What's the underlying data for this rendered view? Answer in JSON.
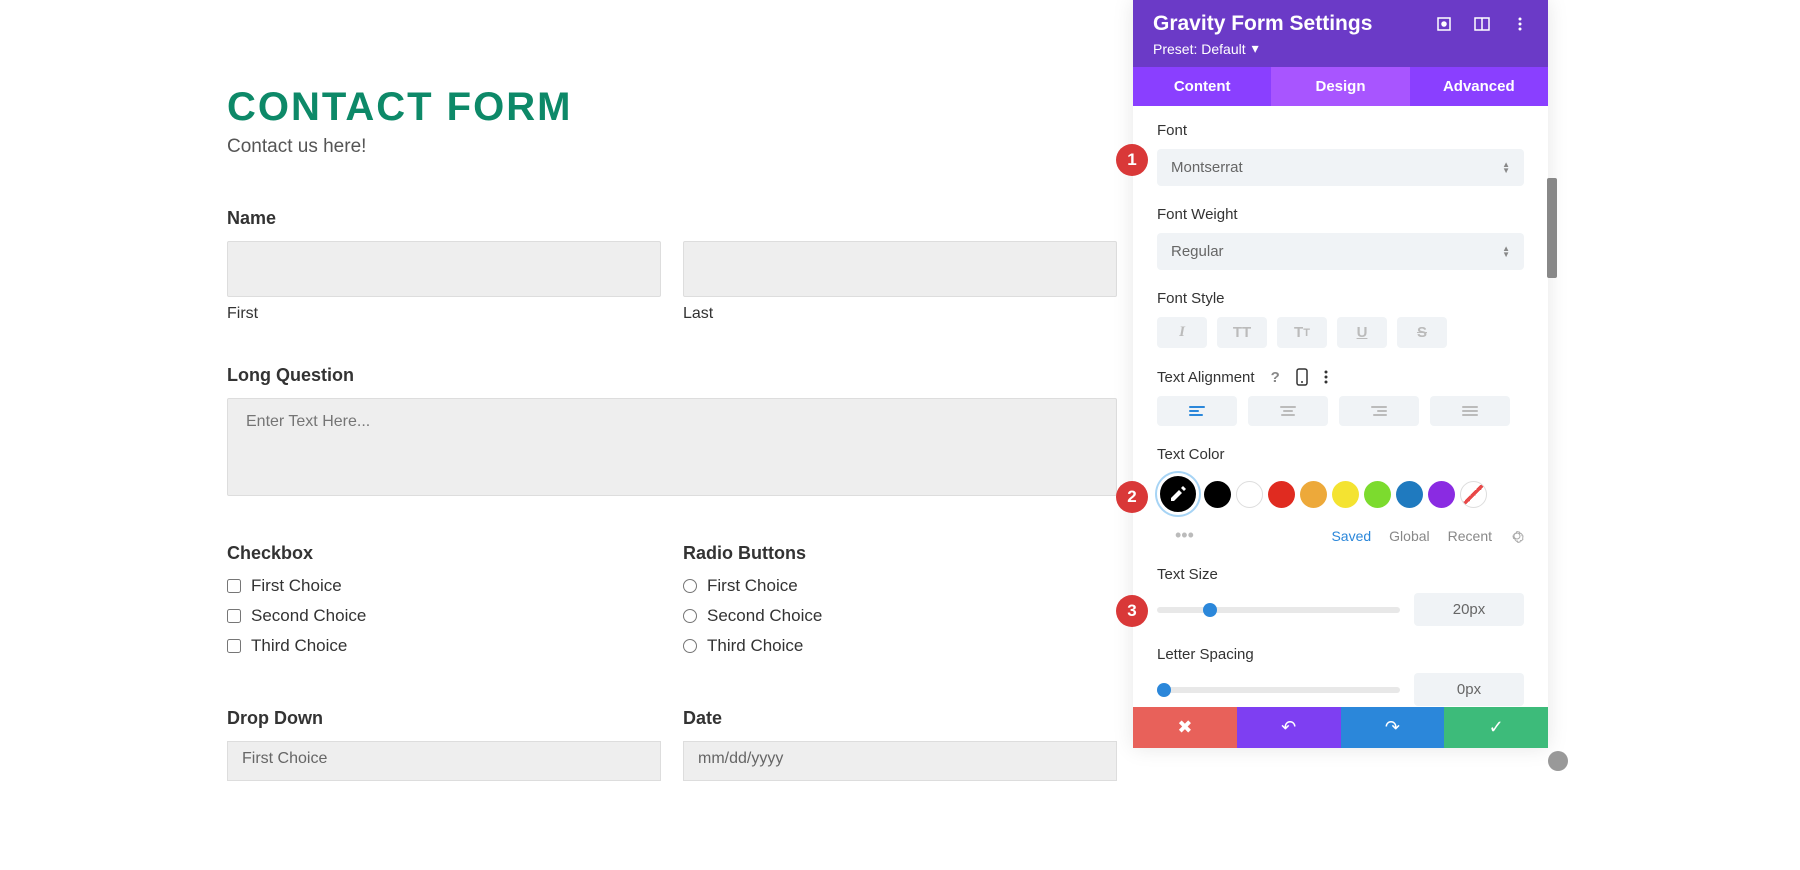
{
  "form": {
    "title": "CONTACT FORM",
    "subtitle": "Contact us here!",
    "name_label": "Name",
    "first_label": "First",
    "last_label": "Last",
    "long_question_label": "Long Question",
    "long_question_placeholder": "Enter Text Here...",
    "checkbox_label": "Checkbox",
    "radio_label": "Radio Buttons",
    "choices": [
      "First Choice",
      "Second Choice",
      "Third Choice"
    ],
    "dropdown_label": "Drop Down",
    "dropdown_value": "First Choice",
    "date_label": "Date",
    "date_placeholder": "mm/dd/yyyy"
  },
  "panel": {
    "title": "Gravity Form Settings",
    "preset_label": "Preset: Default",
    "tabs": {
      "content": "Content",
      "design": "Design",
      "advanced": "Advanced"
    },
    "font_label": "Font",
    "font_value": "Montserrat",
    "font_weight_label": "Font Weight",
    "font_weight_value": "Regular",
    "font_style_label": "Font Style",
    "text_alignment_label": "Text Alignment",
    "text_color_label": "Text Color",
    "color_tabs": {
      "saved": "Saved",
      "global": "Global",
      "recent": "Recent"
    },
    "text_size_label": "Text Size",
    "text_size_value": "20px",
    "letter_spacing_label": "Letter Spacing",
    "letter_spacing_value": "0px",
    "colors": [
      "#000000",
      "#ffffff",
      "#e02b20",
      "#eda93a",
      "#f4e331",
      "#7cdb2e",
      "#1f7abf",
      "#8a2be2"
    ]
  },
  "markers": {
    "m1": "1",
    "m2": "2",
    "m3": "3"
  }
}
